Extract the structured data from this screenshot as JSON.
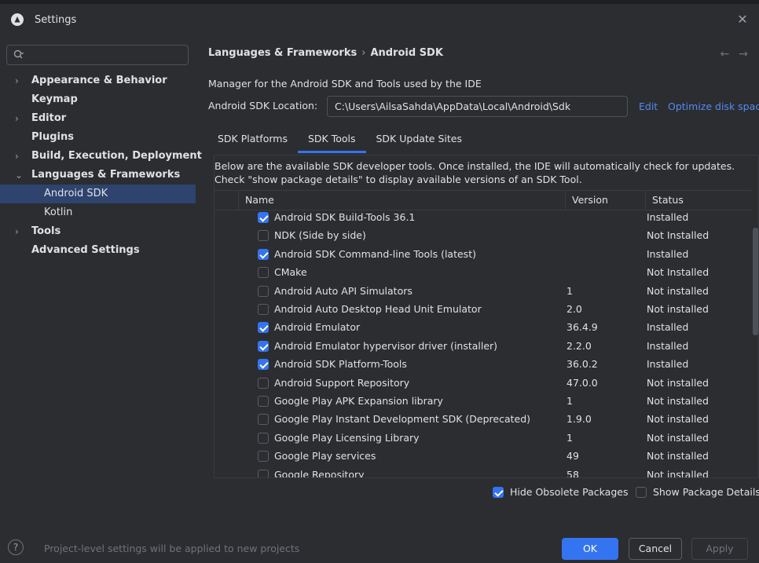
{
  "window": {
    "title": "Settings",
    "close": "✕"
  },
  "search": {
    "placeholder": "",
    "value": ""
  },
  "sidebar": {
    "items": [
      {
        "label": "Appearance & Behavior",
        "chevron": "›",
        "level": 0
      },
      {
        "label": "Keymap",
        "chevron": "",
        "level": 0
      },
      {
        "label": "Editor",
        "chevron": "›",
        "level": 0
      },
      {
        "label": "Plugins",
        "chevron": "",
        "level": 0
      },
      {
        "label": "Build, Execution, Deployment",
        "chevron": "›",
        "level": 0
      },
      {
        "label": "Languages & Frameworks",
        "chevron": "⌄",
        "level": 0
      },
      {
        "label": "Android SDK",
        "chevron": "",
        "level": 1,
        "selected": true
      },
      {
        "label": "Kotlin",
        "chevron": "",
        "level": 1
      },
      {
        "label": "Tools",
        "chevron": "›",
        "level": 0
      },
      {
        "label": "Advanced Settings",
        "chevron": "",
        "level": 0
      }
    ]
  },
  "header": {
    "crumb1": "Languages & Frameworks",
    "crumb_sep": "›",
    "crumb2": "Android SDK",
    "back": "←",
    "forward": "→"
  },
  "main": {
    "description": "Manager for the Android SDK and Tools used by the IDE",
    "location_label": "Android SDK Location:",
    "location_value": "C:\\Users\\AilsaSahda\\AppData\\Local\\Android\\Sdk",
    "edit_link": "Edit",
    "optimize_link": "Optimize disk space",
    "tabs": [
      {
        "label": "SDK Platforms",
        "active": false
      },
      {
        "label": "SDK Tools",
        "active": true
      },
      {
        "label": "SDK Update Sites",
        "active": false
      }
    ],
    "panel_description": "Below are the available SDK developer tools. Once installed, the IDE will automatically check for updates. Check \"show package details\" to display available versions of an SDK Tool.",
    "columns": {
      "name": "Name",
      "version": "Version",
      "status": "Status"
    },
    "rows": [
      {
        "checked": true,
        "name": "Android SDK Build-Tools 36.1",
        "version": "",
        "status": "Installed"
      },
      {
        "checked": false,
        "name": "NDK (Side by side)",
        "version": "",
        "status": "Not Installed"
      },
      {
        "checked": true,
        "name": "Android SDK Command-line Tools (latest)",
        "version": "",
        "status": "Installed"
      },
      {
        "checked": false,
        "name": "CMake",
        "version": "",
        "status": "Not Installed"
      },
      {
        "checked": false,
        "name": "Android Auto API Simulators",
        "version": "1",
        "status": "Not installed"
      },
      {
        "checked": false,
        "name": "Android Auto Desktop Head Unit Emulator",
        "version": "2.0",
        "status": "Not installed"
      },
      {
        "checked": true,
        "name": "Android Emulator",
        "version": "36.4.9",
        "status": "Installed"
      },
      {
        "checked": true,
        "name": "Android Emulator hypervisor driver (installer)",
        "version": "2.2.0",
        "status": "Installed"
      },
      {
        "checked": true,
        "name": "Android SDK Platform-Tools",
        "version": "36.0.2",
        "status": "Installed"
      },
      {
        "checked": false,
        "name": "Android Support Repository",
        "version": "47.0.0",
        "status": "Not installed"
      },
      {
        "checked": false,
        "name": "Google Play APK Expansion library",
        "version": "1",
        "status": "Not installed"
      },
      {
        "checked": false,
        "name": "Google Play Instant Development SDK (Deprecated)",
        "version": "1.9.0",
        "status": "Not installed"
      },
      {
        "checked": false,
        "name": "Google Play Licensing Library",
        "version": "1",
        "status": "Not installed"
      },
      {
        "checked": false,
        "name": "Google Play services",
        "version": "49",
        "status": "Not installed"
      },
      {
        "checked": false,
        "name": "Google Repository",
        "version": "58",
        "status": "Not installed"
      }
    ],
    "hide_obsolete": {
      "label": "Hide Obsolete Packages",
      "checked": true
    },
    "show_details": {
      "label": "Show Package Details",
      "checked": false
    }
  },
  "footer": {
    "help": "?",
    "hint": "Project-level settings will be applied to new projects",
    "ok": "OK",
    "cancel": "Cancel",
    "apply": "Apply"
  },
  "colors": {
    "accent": "#3574f0",
    "link": "#548af7",
    "selection": "#2e436e",
    "background": "#2b2d30"
  }
}
